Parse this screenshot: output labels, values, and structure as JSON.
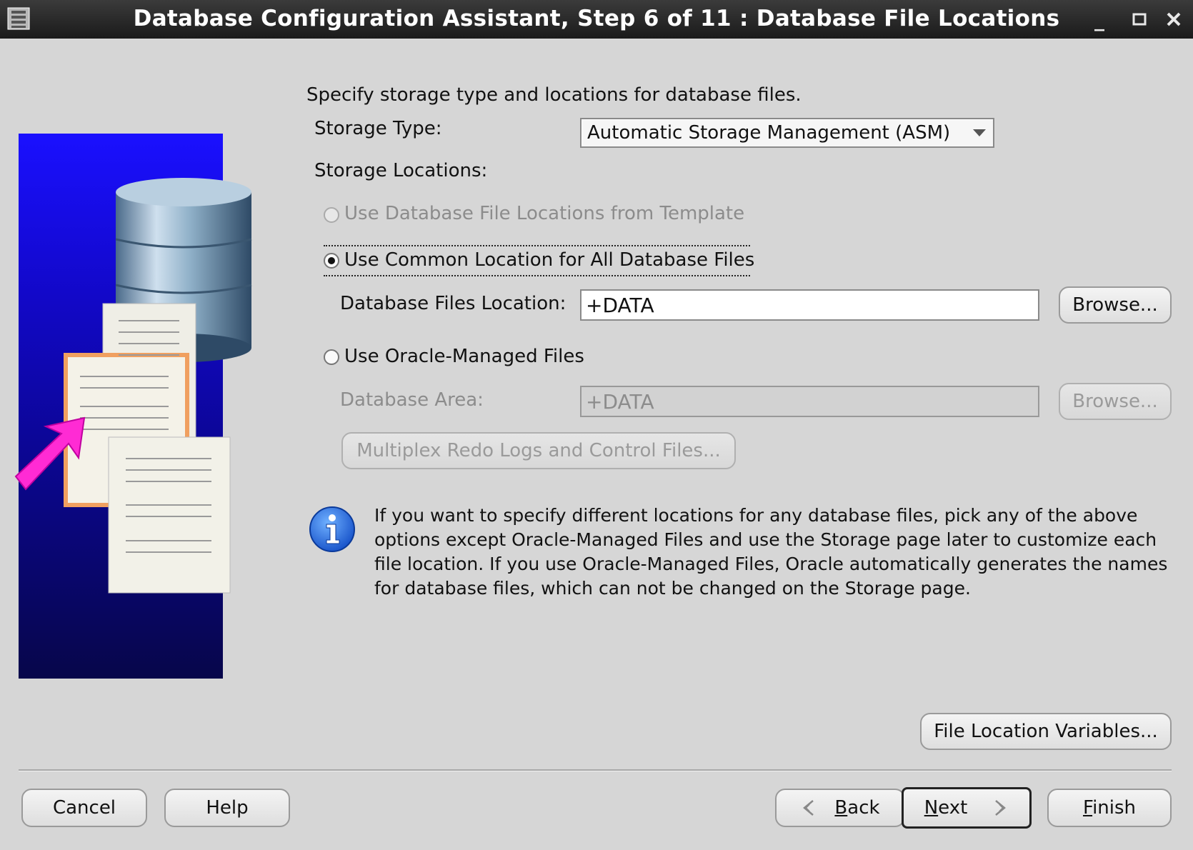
{
  "window": {
    "title": "Database Configuration Assistant, Step 6 of 11 : Database File Locations"
  },
  "intro": "Specify storage type and locations for database files.",
  "storage_type": {
    "label": "Storage Type:",
    "value": "Automatic Storage Management (ASM)"
  },
  "storage_locations": {
    "label": "Storage Locations:",
    "options": [
      {
        "label": "Use Database File Locations from Template",
        "selected": false,
        "enabled": false
      },
      {
        "label": "Use Common Location for All Database Files",
        "selected": true,
        "enabled": true
      },
      {
        "label": "Use Oracle-Managed Files",
        "selected": false,
        "enabled": true
      }
    ]
  },
  "common_location": {
    "label": "Database Files Location:",
    "value": "+DATA",
    "browse_label": "Browse..."
  },
  "oracle_managed": {
    "area_label": "Database Area:",
    "area_value": "+DATA",
    "browse_label": "Browse...",
    "multiplex_label": "Multiplex Redo Logs and Control Files..."
  },
  "info": {
    "text": "If you want to specify different locations for any database files, pick any of the above options except Oracle-Managed Files and use the Storage page later to customize each file location. If you use Oracle-Managed Files, Oracle automatically generates the names for database files, which can not be changed on the Storage page."
  },
  "file_location_variables_label": "File Location Variables...",
  "footer": {
    "cancel": "Cancel",
    "help": "Help",
    "back": "ack",
    "back_mnemonic": "B",
    "next": "ext",
    "next_mnemonic": "N",
    "finish": "inish",
    "finish_mnemonic": "F"
  },
  "colors": {
    "background": "#d6d6d6",
    "titlebar": "#1a1a1a",
    "sidebar_blue": "#1208c8",
    "info_blue": "#1f6fe0"
  }
}
